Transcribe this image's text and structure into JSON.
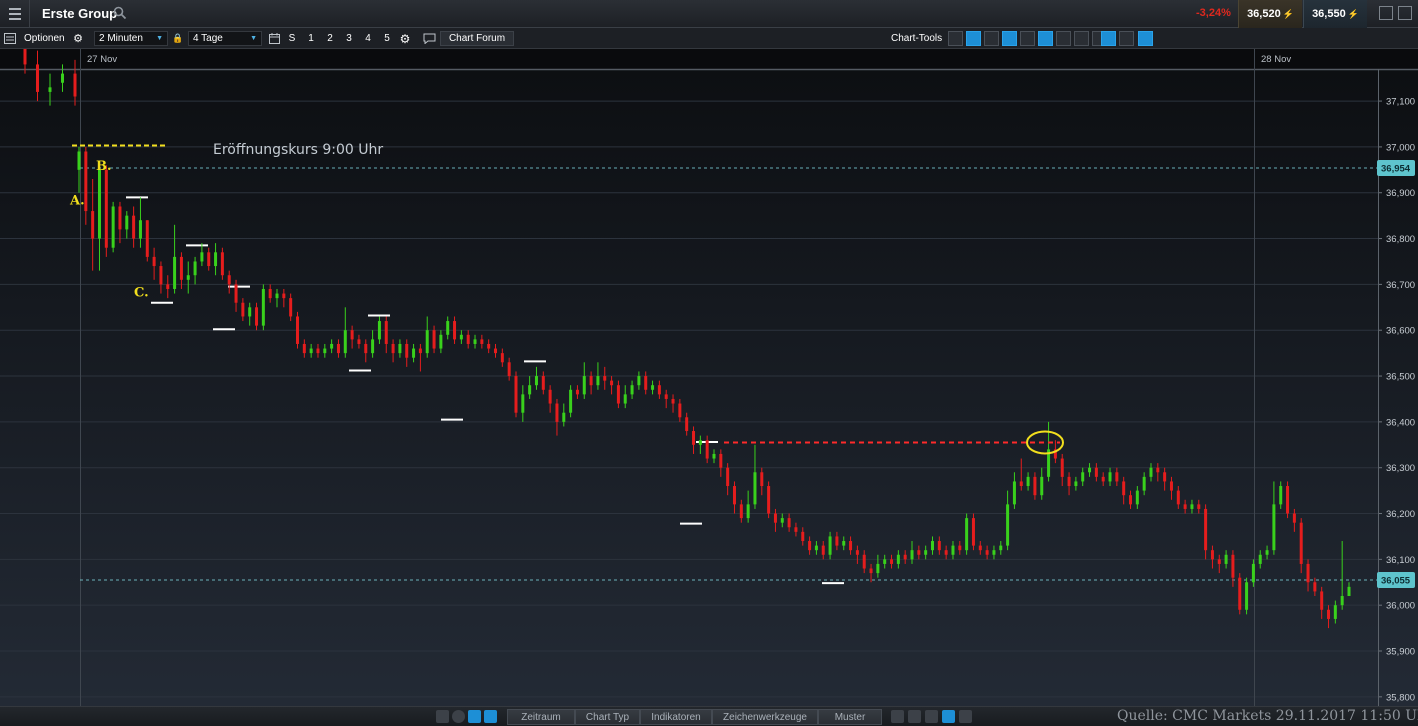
{
  "header": {
    "instrument": "Erste Group",
    "change": "-3,24%",
    "sell_price": "36,520",
    "buy_price": "36,550"
  },
  "toolbar": {
    "options_label": "Optionen",
    "interval": "2 Minuten",
    "range": "4 Tage",
    "quick_buttons": [
      "S",
      "1",
      "2",
      "3",
      "4",
      "5"
    ],
    "forum_label": "Chart Forum",
    "chart_tools_label": "Chart-Tools"
  },
  "bottom": {
    "tabs": [
      "Zeitraum",
      "Chart Typ",
      "Indikatoren",
      "Zeichenwerkzeuge",
      "Muster"
    ],
    "source": "Quelle: CMC Markets 29.11.2017 11:50 Uhr"
  },
  "chart_data": {
    "type": "candlestick",
    "title": "",
    "x_ticks": [
      "27 Nov",
      "28 Nov"
    ],
    "y_ticks": [
      "37,100",
      "37,000",
      "36,900",
      "36,800",
      "36,700",
      "36,600",
      "36,500",
      "36,400",
      "36,300",
      "36,200",
      "36,100",
      "36,000",
      "35,900",
      "35,800"
    ],
    "ylim": [
      35.78,
      37.17
    ],
    "colors": {
      "up": "#39d11c",
      "down": "#e51d1d",
      "annotation": "#f2df1d",
      "level": "#ffffff"
    },
    "price_tags": [
      {
        "label": "36,954",
        "value": 36.954
      },
      {
        "label": "36,055",
        "value": 36.055
      }
    ],
    "annotations": {
      "opening_text": "Eröffnungskurs  9:00 Uhr",
      "letters": [
        {
          "text": "A.",
          "value": 36.885
        },
        {
          "text": "B.",
          "value": 36.96
        },
        {
          "text": "C.",
          "value": 36.685
        }
      ],
      "opening_dashed_value": 37.003,
      "resistance_value": 36.355
    },
    "swing_levels": [
      {
        "value": 36.89,
        "kind": "high"
      },
      {
        "value": 36.66,
        "kind": "low"
      },
      {
        "value": 36.785,
        "kind": "high"
      },
      {
        "value": 36.602,
        "kind": "low"
      },
      {
        "value": 36.695,
        "kind": "high"
      },
      {
        "value": 36.512,
        "kind": "low"
      },
      {
        "value": 36.632,
        "kind": "high"
      },
      {
        "value": 36.405,
        "kind": "low"
      },
      {
        "value": 36.532,
        "kind": "high"
      },
      {
        "value": 36.178,
        "kind": "low"
      },
      {
        "value": 36.356,
        "kind": "high"
      },
      {
        "value": 36.048,
        "kind": "low"
      }
    ],
    "candles": [
      [
        37.22,
        37.18,
        37.24,
        37.16
      ],
      [
        37.18,
        37.12,
        37.21,
        37.1
      ],
      [
        37.12,
        37.13,
        37.16,
        37.09
      ],
      [
        37.14,
        37.16,
        37.18,
        37.12
      ],
      [
        37.16,
        37.11,
        37.19,
        37.09
      ],
      [
        36.95,
        36.99,
        37.0,
        36.9
      ],
      [
        36.99,
        36.86,
        37.0,
        36.83
      ],
      [
        36.86,
        36.8,
        36.93,
        36.73
      ],
      [
        36.8,
        36.95,
        36.96,
        36.73
      ],
      [
        36.95,
        36.78,
        36.96,
        36.76
      ],
      [
        36.78,
        36.87,
        36.88,
        36.77
      ],
      [
        36.87,
        36.82,
        36.88,
        36.79
      ],
      [
        36.82,
        36.85,
        36.86,
        36.8
      ],
      [
        36.85,
        36.8,
        36.87,
        36.78
      ],
      [
        36.8,
        36.84,
        36.89,
        36.78
      ],
      [
        36.84,
        36.76,
        36.84,
        36.75
      ],
      [
        36.76,
        36.74,
        36.78,
        36.71
      ],
      [
        36.74,
        36.7,
        36.75,
        36.68
      ],
      [
        36.7,
        36.69,
        36.72,
        36.67
      ],
      [
        36.69,
        36.76,
        36.83,
        36.68
      ],
      [
        36.76,
        36.71,
        36.77,
        36.69
      ],
      [
        36.71,
        36.72,
        36.75,
        36.68
      ],
      [
        36.72,
        36.75,
        36.76,
        36.7
      ],
      [
        36.75,
        36.77,
        36.79,
        36.74
      ],
      [
        36.77,
        36.74,
        36.78,
        36.73
      ],
      [
        36.74,
        36.77,
        36.79,
        36.72
      ],
      [
        36.77,
        36.72,
        36.78,
        36.71
      ],
      [
        36.72,
        36.7,
        36.73,
        36.68
      ],
      [
        36.7,
        36.66,
        36.71,
        36.64
      ],
      [
        36.66,
        36.63,
        36.67,
        36.62
      ],
      [
        36.63,
        36.65,
        36.66,
        36.61
      ],
      [
        36.65,
        36.61,
        36.66,
        36.6
      ],
      [
        36.61,
        36.69,
        36.7,
        36.6
      ],
      [
        36.69,
        36.67,
        36.7,
        36.66
      ],
      [
        36.67,
        36.68,
        36.69,
        36.65
      ],
      [
        36.68,
        36.67,
        36.69,
        36.65
      ],
      [
        36.67,
        36.63,
        36.68,
        36.62
      ],
      [
        36.63,
        36.57,
        36.64,
        36.56
      ],
      [
        36.57,
        36.55,
        36.58,
        36.54
      ],
      [
        36.55,
        36.56,
        36.57,
        36.54
      ],
      [
        36.56,
        36.55,
        36.57,
        36.54
      ],
      [
        36.55,
        36.56,
        36.57,
        36.54
      ],
      [
        36.56,
        36.57,
        36.58,
        36.55
      ],
      [
        36.57,
        36.55,
        36.58,
        36.54
      ],
      [
        36.55,
        36.6,
        36.65,
        36.54
      ],
      [
        36.6,
        36.58,
        36.61,
        36.56
      ],
      [
        36.58,
        36.57,
        36.59,
        36.56
      ],
      [
        36.57,
        36.55,
        36.58,
        36.53
      ],
      [
        36.55,
        36.58,
        36.6,
        36.54
      ],
      [
        36.58,
        36.62,
        36.63,
        36.57
      ],
      [
        36.62,
        36.57,
        36.63,
        36.55
      ],
      [
        36.57,
        36.55,
        36.58,
        36.53
      ],
      [
        36.55,
        36.57,
        36.58,
        36.54
      ],
      [
        36.57,
        36.54,
        36.58,
        36.52
      ],
      [
        36.54,
        36.56,
        36.57,
        36.53
      ],
      [
        36.56,
        36.55,
        36.57,
        36.51
      ],
      [
        36.55,
        36.6,
        36.63,
        36.54
      ],
      [
        36.6,
        36.56,
        36.61,
        36.55
      ],
      [
        36.56,
        36.59,
        36.6,
        36.55
      ],
      [
        36.59,
        36.62,
        36.63,
        36.58
      ],
      [
        36.62,
        36.58,
        36.63,
        36.57
      ],
      [
        36.58,
        36.59,
        36.6,
        36.57
      ],
      [
        36.59,
        36.57,
        36.6,
        36.56
      ],
      [
        36.57,
        36.58,
        36.59,
        36.56
      ],
      [
        36.58,
        36.57,
        36.59,
        36.56
      ],
      [
        36.57,
        36.56,
        36.58,
        36.55
      ],
      [
        36.56,
        36.55,
        36.57,
        36.54
      ],
      [
        36.55,
        36.53,
        36.56,
        36.52
      ],
      [
        36.53,
        36.5,
        36.54,
        36.49
      ],
      [
        36.5,
        36.42,
        36.51,
        36.41
      ],
      [
        36.42,
        36.46,
        36.48,
        36.4
      ],
      [
        36.46,
        36.48,
        36.5,
        36.45
      ],
      [
        36.48,
        36.5,
        36.52,
        36.47
      ],
      [
        36.5,
        36.47,
        36.51,
        36.46
      ],
      [
        36.47,
        36.44,
        36.48,
        36.42
      ],
      [
        36.44,
        36.4,
        36.45,
        36.37
      ],
      [
        36.4,
        36.42,
        36.44,
        36.39
      ],
      [
        36.42,
        36.47,
        36.48,
        36.41
      ],
      [
        36.47,
        36.46,
        36.48,
        36.45
      ],
      [
        36.46,
        36.5,
        36.53,
        36.45
      ],
      [
        36.5,
        36.48,
        36.51,
        36.46
      ],
      [
        36.48,
        36.5,
        36.53,
        36.47
      ],
      [
        36.5,
        36.49,
        36.52,
        36.47
      ],
      [
        36.49,
        36.48,
        36.5,
        36.46
      ],
      [
        36.48,
        36.44,
        36.49,
        36.43
      ],
      [
        36.44,
        36.46,
        36.48,
        36.43
      ],
      [
        36.46,
        36.48,
        36.49,
        36.45
      ],
      [
        36.48,
        36.5,
        36.51,
        36.47
      ],
      [
        36.5,
        36.47,
        36.51,
        36.46
      ],
      [
        36.47,
        36.48,
        36.49,
        36.46
      ],
      [
        36.48,
        36.46,
        36.49,
        36.45
      ],
      [
        36.46,
        36.45,
        36.47,
        36.43
      ],
      [
        36.45,
        36.44,
        36.46,
        36.42
      ],
      [
        36.44,
        36.41,
        36.45,
        36.4
      ],
      [
        36.41,
        36.38,
        36.42,
        36.37
      ],
      [
        36.38,
        36.35,
        36.39,
        36.33
      ],
      [
        36.35,
        36.36,
        36.37,
        36.33
      ],
      [
        36.36,
        36.32,
        36.37,
        36.31
      ],
      [
        36.32,
        36.33,
        36.34,
        36.31
      ],
      [
        36.33,
        36.3,
        36.34,
        36.28
      ],
      [
        36.3,
        36.26,
        36.31,
        36.24
      ],
      [
        36.26,
        36.22,
        36.27,
        36.2
      ],
      [
        36.22,
        36.19,
        36.23,
        36.18
      ],
      [
        36.19,
        36.22,
        36.25,
        36.18
      ],
      [
        36.22,
        36.29,
        36.35,
        36.21
      ],
      [
        36.29,
        36.26,
        36.3,
        36.24
      ],
      [
        36.26,
        36.2,
        36.27,
        36.19
      ],
      [
        36.2,
        36.18,
        36.21,
        36.16
      ],
      [
        36.18,
        36.19,
        36.2,
        36.17
      ],
      [
        36.19,
        36.17,
        36.2,
        36.16
      ],
      [
        36.17,
        36.16,
        36.18,
        36.15
      ],
      [
        36.16,
        36.14,
        36.17,
        36.13
      ],
      [
        36.14,
        36.12,
        36.15,
        36.11
      ],
      [
        36.12,
        36.13,
        36.14,
        36.11
      ],
      [
        36.13,
        36.11,
        36.14,
        36.1
      ],
      [
        36.11,
        36.15,
        36.16,
        36.1
      ],
      [
        36.15,
        36.13,
        36.16,
        36.12
      ],
      [
        36.13,
        36.14,
        36.15,
        36.12
      ],
      [
        36.14,
        36.12,
        36.15,
        36.11
      ],
      [
        36.12,
        36.11,
        36.13,
        36.09
      ],
      [
        36.11,
        36.08,
        36.12,
        36.07
      ],
      [
        36.08,
        36.07,
        36.09,
        36.05
      ],
      [
        36.07,
        36.09,
        36.11,
        36.06
      ],
      [
        36.09,
        36.1,
        36.11,
        36.08
      ],
      [
        36.1,
        36.09,
        36.11,
        36.08
      ],
      [
        36.09,
        36.11,
        36.12,
        36.08
      ],
      [
        36.11,
        36.1,
        36.12,
        36.09
      ],
      [
        36.1,
        36.12,
        36.14,
        36.09
      ],
      [
        36.12,
        36.11,
        36.13,
        36.1
      ],
      [
        36.11,
        36.12,
        36.13,
        36.1
      ],
      [
        36.12,
        36.14,
        36.15,
        36.11
      ],
      [
        36.14,
        36.12,
        36.15,
        36.11
      ],
      [
        36.12,
        36.11,
        36.13,
        36.1
      ],
      [
        36.11,
        36.13,
        36.14,
        36.1
      ],
      [
        36.13,
        36.12,
        36.14,
        36.11
      ],
      [
        36.12,
        36.19,
        36.2,
        36.11
      ],
      [
        36.19,
        36.13,
        36.2,
        36.12
      ],
      [
        36.13,
        36.12,
        36.14,
        36.11
      ],
      [
        36.12,
        36.11,
        36.13,
        36.1
      ],
      [
        36.11,
        36.12,
        36.13,
        36.1
      ],
      [
        36.12,
        36.13,
        36.14,
        36.11
      ],
      [
        36.13,
        36.22,
        36.25,
        36.12
      ],
      [
        36.22,
        36.27,
        36.29,
        36.21
      ],
      [
        36.27,
        36.26,
        36.32,
        36.25
      ],
      [
        36.26,
        36.28,
        36.29,
        36.25
      ],
      [
        36.28,
        36.24,
        36.29,
        36.23
      ],
      [
        36.24,
        36.28,
        36.3,
        36.23
      ],
      [
        36.28,
        36.34,
        36.4,
        36.27
      ],
      [
        36.34,
        36.32,
        36.36,
        36.31
      ],
      [
        36.32,
        36.28,
        36.33,
        36.26
      ],
      [
        36.28,
        36.26,
        36.29,
        36.24
      ],
      [
        36.26,
        36.27,
        36.28,
        36.25
      ],
      [
        36.27,
        36.29,
        36.3,
        36.26
      ],
      [
        36.29,
        36.3,
        36.31,
        36.28
      ],
      [
        36.3,
        36.28,
        36.31,
        36.27
      ],
      [
        36.28,
        36.27,
        36.29,
        36.26
      ],
      [
        36.27,
        36.29,
        36.3,
        36.26
      ],
      [
        36.29,
        36.27,
        36.3,
        36.26
      ],
      [
        36.27,
        36.24,
        36.28,
        36.22
      ],
      [
        36.24,
        36.22,
        36.25,
        36.21
      ],
      [
        36.22,
        36.25,
        36.26,
        36.21
      ],
      [
        36.25,
        36.28,
        36.29,
        36.24
      ],
      [
        36.28,
        36.3,
        36.31,
        36.27
      ],
      [
        36.3,
        36.29,
        36.31,
        36.27
      ],
      [
        36.29,
        36.27,
        36.3,
        36.25
      ],
      [
        36.27,
        36.25,
        36.28,
        36.23
      ],
      [
        36.25,
        36.22,
        36.26,
        36.21
      ],
      [
        36.22,
        36.21,
        36.23,
        36.2
      ],
      [
        36.21,
        36.22,
        36.23,
        36.2
      ],
      [
        36.22,
        36.21,
        36.23,
        36.2
      ],
      [
        36.21,
        36.12,
        36.22,
        36.1
      ],
      [
        36.12,
        36.1,
        36.13,
        36.08
      ],
      [
        36.1,
        36.09,
        36.11,
        36.07
      ],
      [
        36.09,
        36.11,
        36.12,
        36.08
      ],
      [
        36.11,
        36.06,
        36.12,
        36.04
      ],
      [
        36.06,
        35.99,
        36.07,
        35.98
      ],
      [
        35.99,
        36.05,
        36.06,
        35.98
      ],
      [
        36.05,
        36.09,
        36.1,
        36.04
      ],
      [
        36.09,
        36.11,
        36.12,
        36.08
      ],
      [
        36.11,
        36.12,
        36.13,
        36.1
      ],
      [
        36.12,
        36.22,
        36.27,
        36.11
      ],
      [
        36.22,
        36.26,
        36.27,
        36.21
      ],
      [
        36.26,
        36.2,
        36.27,
        36.19
      ],
      [
        36.2,
        36.18,
        36.21,
        36.16
      ],
      [
        36.18,
        36.09,
        36.19,
        36.07
      ],
      [
        36.09,
        36.05,
        36.1,
        36.03
      ],
      [
        36.05,
        36.03,
        36.06,
        36.02
      ],
      [
        36.03,
        35.99,
        36.04,
        35.97
      ],
      [
        35.99,
        35.97,
        36.0,
        35.95
      ],
      [
        35.97,
        36.0,
        36.01,
        35.96
      ],
      [
        36.0,
        36.02,
        36.14,
        35.99
      ],
      [
        36.02,
        36.04,
        36.05,
        36.02
      ]
    ]
  }
}
